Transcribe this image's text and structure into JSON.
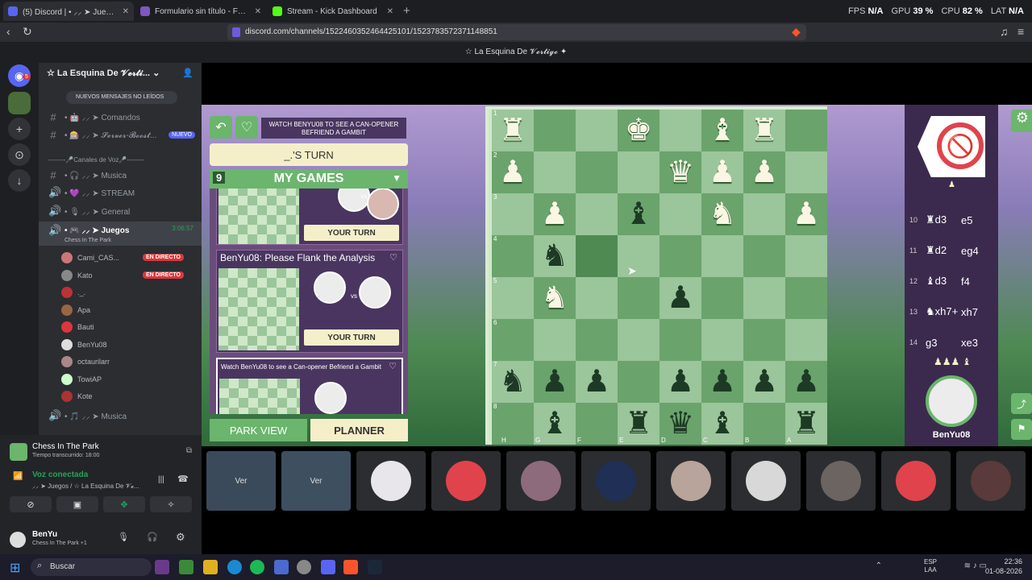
{
  "browser": {
    "tabs": [
      {
        "label": "(5) Discord | • ⸝⸝ ➤ Juegos | ⭑",
        "active": true,
        "color": "#5865f2"
      },
      {
        "label": "Formulario sin título - Formularios de",
        "active": false,
        "color": "#7e57c2"
      },
      {
        "label": "Stream - Kick Dashboard",
        "active": false,
        "color": "#53fc18"
      }
    ],
    "new_tab": "+",
    "perf": {
      "fps_label": "FPS",
      "fps": "N/A",
      "gpu_label": "GPU",
      "gpu": "39 %",
      "cpu_label": "CPU",
      "cpu": "82 %",
      "lat_label": "LAT",
      "lat": "N/A"
    },
    "url": "discord.com/channels/1522460352464425101/1523783572371148851"
  },
  "discord": {
    "window_title": "☆ La Esquina De 𝓥𝓮𝓻𝓽𝓲𝓰𝓸 ✦",
    "rail_badge": "5",
    "server_name": "☆ La Esquina De 𝓥𝓮𝓻𝓽𝓲...",
    "new_messages": "NUEVOS MENSAJES NO LEÍDOS",
    "channels": [
      {
        "icon": "#",
        "label": "• 🤖 ⸝⸝ ➤ Comandos"
      },
      {
        "icon": "#",
        "label": "• 🎰 ⸝⸝ ➤ 𝓢𝓮𝓻𝓿𝓮𝓻-𝓑𝓸𝓸𝓼𝓽...",
        "badge": "NUEVO"
      }
    ],
    "voice_category": "--------🎤Canales de Voz🎤--------",
    "voice_channels": [
      {
        "icon": "#",
        "label": "• 🎧 ⸝⸝ ➤ Musica"
      },
      {
        "icon": "🔊",
        "label": "• 💜 ⸝⸝ ➤ STREAM"
      },
      {
        "icon": "🔊",
        "label": "• 🎙 ⸝⸝ ➤ General"
      }
    ],
    "current_channel": {
      "label": "• 🎮 ⸝⸝ ➤ Juegos",
      "time": "3:06:57",
      "activity": "Chess In The Park"
    },
    "users": [
      {
        "name": "Cami_CAS...",
        "live": "EN DIRECTO",
        "color": "#c77"
      },
      {
        "name": "Kato",
        "live": "EN DIRECTO",
        "color": "#888"
      },
      {
        "name": "._.",
        "live": "",
        "color": "#b33"
      },
      {
        "name": "Apa",
        "live": "",
        "color": "#964"
      },
      {
        "name": "Bauti",
        "live": "",
        "color": "#da373c"
      },
      {
        "name": "BenYu08",
        "live": "",
        "color": "#ddd"
      },
      {
        "name": "octaurilarr",
        "live": "",
        "color": "#a88"
      },
      {
        "name": "TowiAP",
        "live": "",
        "color": "#cfc"
      },
      {
        "name": "Kote",
        "live": "",
        "color": "#a33"
      }
    ],
    "last_channel": {
      "icon": "🔊",
      "label": "• 🎵 ⸝⸝ ➤ Musica"
    },
    "activity_panel": {
      "title": "Chess In The Park",
      "subtitle": "Tiempo transcurrido: 18:00"
    },
    "voice_status": {
      "title": "Voz conectada",
      "subtitle": "⸝⸝ ➤ Juegos / ☆ La Esquina De 𝓥𝓮..."
    },
    "me": {
      "name": "BenYu",
      "status": "Chess In The Park +1"
    }
  },
  "game": {
    "banner": "WATCH BENYU08 TO SEE A CAN-OPENER BEFRIEND A GAMBIT",
    "turn": "_.'S TURN",
    "games_count": "9",
    "games_title": "MY GAMES",
    "cards": [
      {
        "title": "",
        "vs": "vs",
        "action": "YOUR TURN"
      },
      {
        "title": "BenYu08: Please Flank the Analysis",
        "vs": "vs",
        "action": "YOUR TURN"
      },
      {
        "title": "Watch BenYu08 to see a Can-opener Befriend a Gambit",
        "vs": "",
        "action": ""
      }
    ],
    "park_view": "PARK VIEW",
    "planner": "PLANNER",
    "ranks": [
      "1",
      "2",
      "3",
      "4",
      "5",
      "6",
      "7",
      "8"
    ],
    "files": [
      "H",
      "G",
      "F",
      "E",
      "D",
      "C",
      "B",
      "A"
    ],
    "board": [
      [
        "w♜",
        "",
        "",
        "w♚",
        "",
        "w♝",
        "w♜",
        ""
      ],
      [
        "w♟",
        "",
        "",
        "",
        "w♛",
        "w♟",
        "w♟",
        ""
      ],
      [
        "",
        "w♟",
        "",
        "b♝",
        "",
        "w♞",
        "",
        "w♟"
      ],
      [
        "",
        "b♞",
        "hl",
        "",
        "",
        "",
        "",
        ""
      ],
      [
        "",
        "w♞",
        "",
        "",
        "b♟",
        "",
        "",
        ""
      ],
      [
        "",
        "",
        "",
        "",
        "",
        "",
        "",
        ""
      ],
      [
        "b♞",
        "b♟",
        "b♟",
        "",
        "b♟",
        "b♟",
        "b♟",
        "b♟"
      ],
      [
        "",
        "b♝",
        "",
        "b♜",
        "b♛",
        "b♝",
        "",
        "b♜"
      ]
    ],
    "moves": [
      {
        "n": "10",
        "a": "♜d3",
        "b": "e5"
      },
      {
        "n": "11",
        "a": "♜d2",
        "b": "eg4"
      },
      {
        "n": "12",
        "a": "♝d3",
        "b": "f4"
      },
      {
        "n": "13",
        "a": "♞xh7+",
        "b": "xh7"
      },
      {
        "n": "14",
        "a": "g3",
        "b": "xe3"
      }
    ],
    "captured": "♟♟♟ ♝",
    "opponent": "BenYu08"
  },
  "participants": [
    {
      "label": "Ver",
      "color": "#3b4a5a"
    },
    {
      "label": "Ver",
      "color": "#3e4f60"
    },
    {
      "label": "",
      "color": "#e8e6ea"
    },
    {
      "label": "",
      "color": "#e0434c"
    },
    {
      "label": "",
      "color": "#8d6a7c"
    },
    {
      "label": "",
      "color": "#1f2f55"
    },
    {
      "label": "",
      "color": "#b8a49a"
    },
    {
      "label": "",
      "color": "#d8d8d8"
    },
    {
      "label": "",
      "color": "#6b6460"
    },
    {
      "label": "",
      "color": "#e0434c"
    },
    {
      "label": "",
      "color": "#5a3a3a"
    }
  ],
  "taskbar": {
    "search": "Buscar",
    "lang": "ESP\nLAA",
    "time": "22:36",
    "date": "01-08-2026"
  }
}
